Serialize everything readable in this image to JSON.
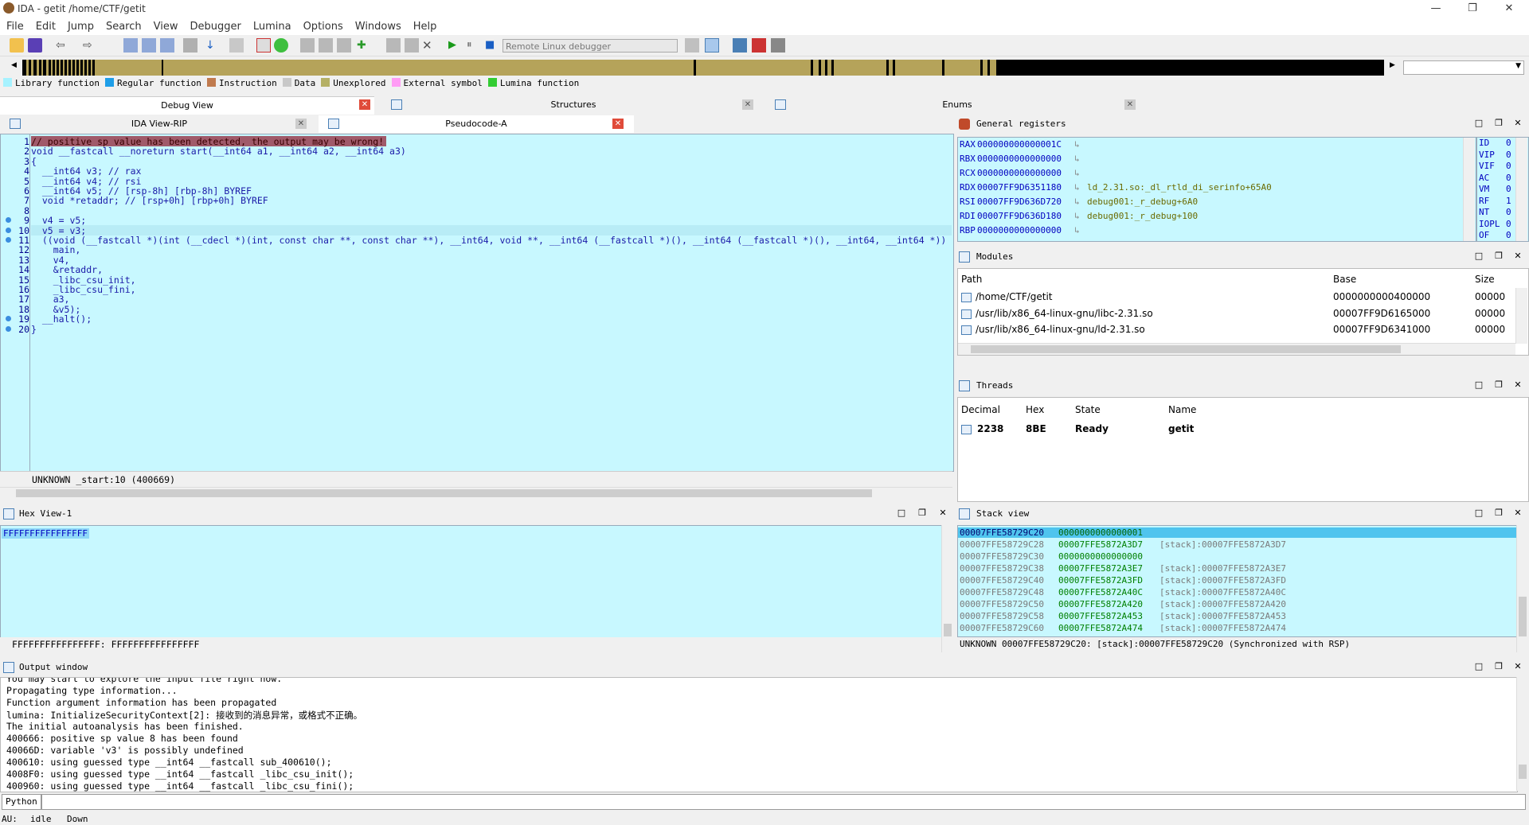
{
  "window": {
    "title": "IDA - getit /home/CTF/getit",
    "minimize": "—",
    "restore": "❐",
    "close": "✕"
  },
  "menu": [
    "File",
    "Edit",
    "Jump",
    "Search",
    "View",
    "Debugger",
    "Lumina",
    "Options",
    "Windows",
    "Help"
  ],
  "toolbar": {
    "debugger_select": "Remote Linux debugger"
  },
  "legend": [
    {
      "label": "Library function",
      "color": "#a6f2ff"
    },
    {
      "label": "Regular function",
      "color": "#1e9ee8"
    },
    {
      "label": "Instruction",
      "color": "#c07a4e"
    },
    {
      "label": "Data",
      "color": "#c8c8c8"
    },
    {
      "label": "Unexplored",
      "color": "#b5b065"
    },
    {
      "label": "External symbol",
      "color": "#ff9cf5"
    },
    {
      "label": "Lumina function",
      "color": "#33cc33"
    }
  ],
  "top_tabs": {
    "debug_view": "Debug View",
    "structures": "Structures",
    "enums": "Enums"
  },
  "code_tabs": {
    "ida_view": "IDA View-RIP",
    "pseudocode": "Pseudocode-A"
  },
  "pseudocode": {
    "lines": [
      {
        "n": "1",
        "t": "// positive sp value has been detected, the output may be wrong!"
      },
      {
        "n": "2",
        "t": "void __fastcall __noreturn start(__int64 a1, __int64 a2, __int64 a3)"
      },
      {
        "n": "3",
        "t": "{"
      },
      {
        "n": "4",
        "t": "  __int64 v3; // rax"
      },
      {
        "n": "5",
        "t": "  __int64 v4; // rsi"
      },
      {
        "n": "6",
        "t": "  __int64 v5; // [rsp-8h] [rbp-8h] BYREF"
      },
      {
        "n": "7",
        "t": "  void *retaddr; // [rsp+0h] [rbp+0h] BYREF"
      },
      {
        "n": "8",
        "t": ""
      },
      {
        "n": "9",
        "t": "  v4 = v5;"
      },
      {
        "n": "10",
        "t": "  v5 = v3;"
      },
      {
        "n": "11",
        "t": "  ((void (__fastcall *)(int (__cdecl *)(int, const char **, const char **), __int64, void **, __int64 (__fastcall *)(), __int64 (__fastcall *)(), __int64, __int64 *))"
      },
      {
        "n": "12",
        "t": "    main,"
      },
      {
        "n": "13",
        "t": "    v4,"
      },
      {
        "n": "14",
        "t": "    &retaddr,"
      },
      {
        "n": "15",
        "t": "    _libc_csu_init,"
      },
      {
        "n": "16",
        "t": "    _libc_csu_fini,"
      },
      {
        "n": "17",
        "t": "    a3,"
      },
      {
        "n": "18",
        "t": "    &v5);"
      },
      {
        "n": "19",
        "t": "  __halt();"
      },
      {
        "n": "20",
        "t": "}"
      }
    ],
    "status": "UNKNOWN _start:10 (400669)"
  },
  "registers": {
    "title": "General registers",
    "rows": [
      {
        "name": "RAX",
        "value": "000000000000001C",
        "label": ""
      },
      {
        "name": "RBX",
        "value": "0000000000000000",
        "label": ""
      },
      {
        "name": "RCX",
        "value": "0000000000000000",
        "label": ""
      },
      {
        "name": "RDX",
        "value": "00007FF9D6351180",
        "label": "ld_2.31.so:_dl_rtld_di_serinfo+65A0"
      },
      {
        "name": "RSI",
        "value": "00007FF9D636D720",
        "label": "debug001:_r_debug+6A0"
      },
      {
        "name": "RDI",
        "value": "00007FF9D636D180",
        "label": "debug001:_r_debug+100"
      },
      {
        "name": "RBP",
        "value": "0000000000000000",
        "label": ""
      }
    ],
    "flags": [
      {
        "name": "ID",
        "value": "0"
      },
      {
        "name": "VIP",
        "value": "0"
      },
      {
        "name": "VIF",
        "value": "0"
      },
      {
        "name": "AC",
        "value": "0"
      },
      {
        "name": "VM",
        "value": "0"
      },
      {
        "name": "RF",
        "value": "1"
      },
      {
        "name": "NT",
        "value": "0"
      },
      {
        "name": "IOPL",
        "value": "0"
      },
      {
        "name": "OF",
        "value": "0"
      }
    ]
  },
  "modules": {
    "title": "Modules",
    "headers": [
      "Path",
      "Base",
      "Size"
    ],
    "rows": [
      {
        "path": "/home/CTF/getit",
        "base": "0000000000400000",
        "size": "00000"
      },
      {
        "path": "/usr/lib/x86_64-linux-gnu/libc-2.31.so",
        "base": "00007FF9D6165000",
        "size": "00000"
      },
      {
        "path": "/usr/lib/x86_64-linux-gnu/ld-2.31.so",
        "base": "00007FF9D6341000",
        "size": "00000"
      }
    ]
  },
  "threads": {
    "title": "Threads",
    "headers": [
      "Decimal",
      "Hex",
      "State",
      "Name"
    ],
    "rows": [
      {
        "decimal": "2238",
        "hex": "8BE",
        "state": "Ready",
        "name": "getit"
      }
    ]
  },
  "hexview": {
    "title": "Hex View-1",
    "line": "FFFFFFFFFFFFFFFF",
    "status": "FFFFFFFFFFFFFFFF: FFFFFFFFFFFFFFFF"
  },
  "stack": {
    "title": "Stack view",
    "rows": [
      {
        "addr": "00007FFE58729C20",
        "val": "0000000000000001",
        "cmt": ""
      },
      {
        "addr": "00007FFE58729C28",
        "val": "00007FFE5872A3D7",
        "cmt": "[stack]:00007FFE5872A3D7"
      },
      {
        "addr": "00007FFE58729C30",
        "val": "0000000000000000",
        "cmt": ""
      },
      {
        "addr": "00007FFE58729C38",
        "val": "00007FFE5872A3E7",
        "cmt": "[stack]:00007FFE5872A3E7"
      },
      {
        "addr": "00007FFE58729C40",
        "val": "00007FFE5872A3FD",
        "cmt": "[stack]:00007FFE5872A3FD"
      },
      {
        "addr": "00007FFE58729C48",
        "val": "00007FFE5872A40C",
        "cmt": "[stack]:00007FFE5872A40C"
      },
      {
        "addr": "00007FFE58729C50",
        "val": "00007FFE5872A420",
        "cmt": "[stack]:00007FFE5872A420"
      },
      {
        "addr": "00007FFE58729C58",
        "val": "00007FFE5872A453",
        "cmt": "[stack]:00007FFE5872A453"
      },
      {
        "addr": "00007FFE58729C60",
        "val": "00007FFE5872A474",
        "cmt": "[stack]:00007FFE5872A474"
      }
    ],
    "status": "UNKNOWN 00007FFE58729C20: [stack]:00007FFE58729C20 (Synchronized with RSP)"
  },
  "output": {
    "title": "Output window",
    "lines": [
      "You may start to explore the input file right now.",
      "Propagating type information...",
      "Function argument information has been propagated",
      "lumina: InitializeSecurityContext[2]: 接收到的消息异常，或格式不正确。",
      "The initial autoanalysis has been finished.",
      "400666: positive sp value 8 has been found",
      "40066D: variable 'v3' is possibly undefined",
      "400610: using guessed type __int64 __fastcall sub_400610();",
      "4008F0: using guessed type __int64 __fastcall _libc_csu_init();",
      "400960: using guessed type __int64 __fastcall _libc_csu_fini();"
    ],
    "python_button": "Python"
  },
  "statusbar": {
    "au_label": "AU:",
    "au_state": "idle",
    "direction": "Down"
  }
}
